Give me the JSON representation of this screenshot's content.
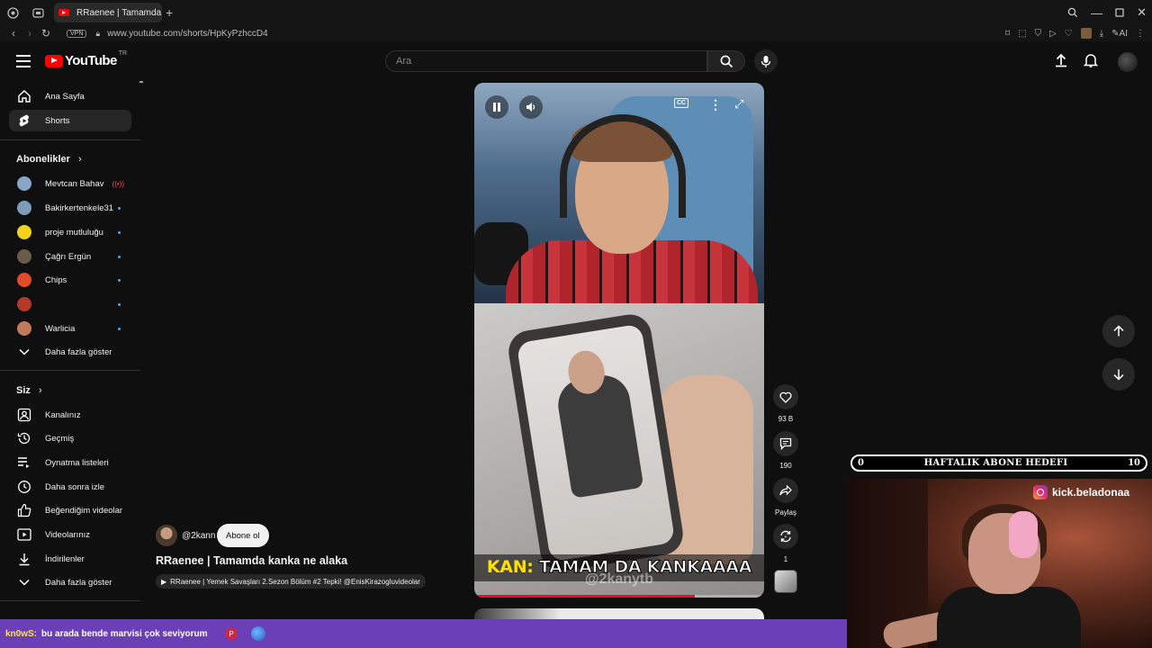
{
  "browser": {
    "tab_title": "RRaenee | Tamamda ka",
    "url": "www.youtube.com/shorts/HpKyPzhccD4",
    "vpn_badge": "VPN",
    "ai_label": "AI"
  },
  "header": {
    "logo_text": "YouTube",
    "region": "TR",
    "search_placeholder": "Ara"
  },
  "sidebar": {
    "main": [
      {
        "label": "Ana Sayfa",
        "icon": "home-icon"
      },
      {
        "label": "Shorts",
        "icon": "shorts-icon",
        "active": true
      }
    ],
    "subscriptions_title": "Abonelikler",
    "subscriptions": [
      {
        "label": "Mevtcan Bahav",
        "color": "#8aa6c7"
      },
      {
        "label": "Bakirkertenkele31",
        "color": "#7e9bb8"
      },
      {
        "label": "proje mutluluğu",
        "color": "#f2d21b"
      },
      {
        "label": "Çağrı Ergün",
        "color": "#6b5b4b"
      },
      {
        "label": "Chips",
        "color": "#e04b2a"
      },
      {
        "label": "",
        "color": "#b33a2a"
      },
      {
        "label": "Warlicia",
        "color": "#c27b5a"
      }
    ],
    "subscriptions_more": "Daha fazla göster",
    "you_title": "Siz",
    "you": [
      {
        "label": "Kanalınız",
        "icon": "channel-icon"
      },
      {
        "label": "Geçmiş",
        "icon": "history-icon"
      },
      {
        "label": "Oynatma listeleri",
        "icon": "playlists-icon"
      },
      {
        "label": "Daha sonra izle",
        "icon": "watch-later-icon"
      },
      {
        "label": "Beğendiğim videolar",
        "icon": "liked-icon"
      },
      {
        "label": "Videolarınız",
        "icon": "your-videos-icon"
      },
      {
        "label": "İndirilenler",
        "icon": "downloads-icon"
      }
    ],
    "you_more": "Daha fazla göster"
  },
  "short": {
    "caption_highlight": "KAN:",
    "caption_text": " TAMAM DA KANKAAAA",
    "watermark": "@2kanytb",
    "progress": 0.76,
    "channel_handle": "@2kann",
    "subscribe_label": "Abone ol",
    "title": "RRaenee | Tamamda kanka ne alaka",
    "related": "RRaenee | Yemek Savaşları 2.Sezon Bölüm #2 Tepki! @EnisKirazogluvideolar",
    "likes": "93 B",
    "comments": "190",
    "share_label": "Paylaş",
    "remix_count": "1"
  },
  "stream": {
    "goal_title": "HAFTALIK ABONE HEDEFI",
    "goal_current": "0",
    "goal_target": "10",
    "goal_progress": 0.0,
    "social_handle": "kick.beladonaa",
    "chat_user": "kn0wS:",
    "chat_message": "bu arada bende marvisi çok seviyorum"
  }
}
